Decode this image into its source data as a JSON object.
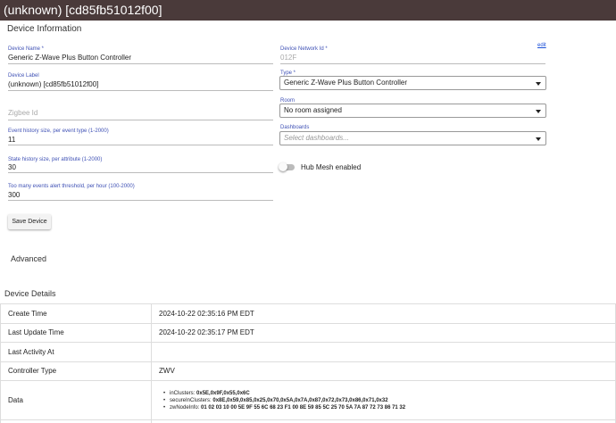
{
  "window_title": "(unknown) [cd85fb51012f00]",
  "device_info": {
    "heading": "Device Information",
    "name": {
      "label": "Device Name *",
      "value": "Generic Z-Wave Plus Button Controller"
    },
    "network_id": {
      "label": "Device Network Id *",
      "value": "012F",
      "edit_label": "edit"
    },
    "device_label": {
      "label": "Device Label",
      "value": "(unknown) [cd85fb51012f00]"
    },
    "type": {
      "label": "Type *",
      "value": "Generic Z-Wave Plus Button Controller"
    },
    "zigbee_id": {
      "placeholder": "Zigbee Id"
    },
    "room": {
      "label": "Room",
      "value": "No room assigned"
    },
    "event_history": {
      "label": "Event history size, per event type (1-2000)",
      "value": "11"
    },
    "dashboards": {
      "label": "Dashboards",
      "placeholder": "Select dashboards..."
    },
    "state_history": {
      "label": "State history size, per attribute (1-2000)",
      "value": "30"
    },
    "hub_mesh": {
      "label": "Hub Mesh enabled",
      "enabled": false
    },
    "alert_threshold": {
      "label": "Too many events alert threshold, per hour (100-2000)",
      "value": "300"
    },
    "save_label": "Save Device"
  },
  "advanced": {
    "heading": "Advanced"
  },
  "device_details": {
    "heading": "Device Details",
    "rows": [
      {
        "key": "Create Time",
        "value": "2024-10-22 02:35:16 PM EDT"
      },
      {
        "key": "Last Update Time",
        "value": "2024-10-22 02:35:17 PM EDT"
      },
      {
        "key": "Last Activity At",
        "value": ""
      },
      {
        "key": "Controller Type",
        "value": "ZWV"
      }
    ],
    "data": {
      "key": "Data",
      "items": [
        {
          "name": "inClusters:",
          "value": "0x5E,0x9F,0x55,0x6C"
        },
        {
          "name": "secureInClusters:",
          "value": "0x8E,0x59,0x85,0x25,0x70,0x5A,0x7A,0x87,0x72,0x73,0x86,0x71,0x32"
        },
        {
          "name": "zwNodeInfo:",
          "value": "01 02 03 10 00 5E 9F 55 6C 68 23 F1 00 8E 59 85 5C 25 70 5A 7A 87 72 73 86 71 32"
        }
      ]
    }
  }
}
